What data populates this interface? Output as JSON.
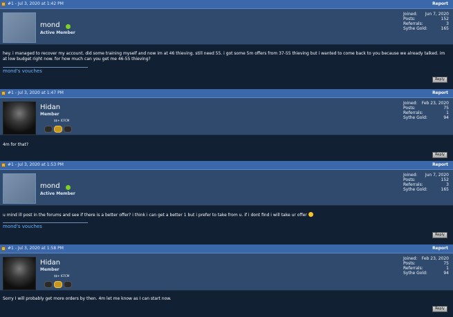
{
  "posts": [
    {
      "date": "#1 - Jul 3, 2020 at 1:42 PM",
      "report": "Report",
      "username": "mond",
      "usertitle": "Active Member",
      "stats": [
        {
          "label": "Joined:",
          "value": "Jun 7, 2020"
        },
        {
          "label": "Posts:",
          "value": "152"
        },
        {
          "label": "Referrals:",
          "value": "3"
        },
        {
          "label": "Sythe Gold:",
          "value": "165"
        }
      ],
      "message": "hey. i managed to recover my account. did some training myself and now im at 46 thieving. still need 55. i got some 5m offers from 37-55 thieving but i wanted to come back to you because we already talked. im at low budget right now. for how much can you get me 46-55 thieving?",
      "vouches": "mond's vouches",
      "reply": "Reply"
    },
    {
      "date": "#1 - Jul 3, 2020 at 1:47 PM",
      "report": "Report",
      "username": "Hidan",
      "usertitle": "Member",
      "badge_text": "$$+ ICFCM",
      "stats": [
        {
          "label": "Joined:",
          "value": "Feb 23, 2020"
        },
        {
          "label": "Posts:",
          "value": "75"
        },
        {
          "label": "Referrals:",
          "value": "1"
        },
        {
          "label": "Sythe Gold:",
          "value": "94"
        }
      ],
      "message": "4m for that?",
      "reply": "Reply"
    },
    {
      "date": "#1 - Jul 3, 2020 at 1:53 PM",
      "report": "Report",
      "username": "mond",
      "usertitle": "Active Member",
      "stats": [
        {
          "label": "Joined:",
          "value": "Jun 7, 2020"
        },
        {
          "label": "Posts:",
          "value": "152"
        },
        {
          "label": "Referrals:",
          "value": "3"
        },
        {
          "label": "Sythe Gold:",
          "value": "165"
        }
      ],
      "message": "u mind ill post in the forums and see if there is a better offer? i think i can get a better 1 but i prefer to take from u. if i dont find i will take ur offer",
      "vouches": "mond's vouches",
      "reply": "Reply"
    },
    {
      "date": "#1 - Jul 3, 2020 at 1:58 PM",
      "report": "Report",
      "username": "Hidan",
      "usertitle": "Member",
      "badge_text": "$$+ ICFCM",
      "stats": [
        {
          "label": "Joined:",
          "value": "Feb 23, 2020"
        },
        {
          "label": "Posts:",
          "value": "75"
        },
        {
          "label": "Referrals:",
          "value": "1"
        },
        {
          "label": "Sythe Gold:",
          "value": "94"
        }
      ],
      "message": "Sorry I will probably get more orders by then. 4m let me know as I can start now.",
      "reply": "Reply"
    }
  ]
}
